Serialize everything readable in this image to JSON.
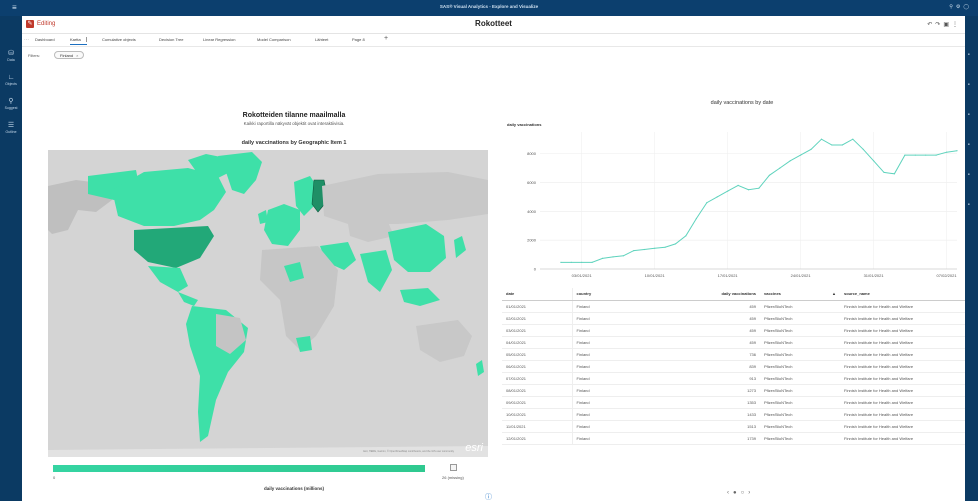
{
  "app_title": "SAS® Visual Analytics - Explore and Visualize",
  "header": {
    "mode_label": "Editing",
    "report_title": "Rokotteet"
  },
  "left_rail": [
    {
      "label": "Data",
      "icon": "database-icon"
    },
    {
      "label": "Objects",
      "icon": "objects-icon"
    },
    {
      "label": "Suggest",
      "icon": "lightbulb-icon"
    },
    {
      "label": "Outline",
      "icon": "outline-icon"
    }
  ],
  "tabs": [
    {
      "label": "Dashboard"
    },
    {
      "label": "Kartta",
      "active": true
    },
    {
      "label": "Cumulative objects"
    },
    {
      "label": "Decision Tree"
    },
    {
      "label": "Linear Regression"
    },
    {
      "label": "Model Comparison"
    },
    {
      "label": "Lähteet"
    },
    {
      "label": "Page 8"
    }
  ],
  "filters": {
    "label": "Filters:",
    "chip": "Finland"
  },
  "left_panel": {
    "title": "Rokotteiden tilanne maailmalla",
    "subtitle": "Kaikki raportilla näkyvät objektit ovat interaktiivisia.",
    "map_title": "daily vaccinations by Geographic Item 1",
    "map_logo": "esri",
    "map_attribution": "Esri, HERE, Garmin, © OpenStreetMap contributors, and the GIS user community",
    "legend": {
      "title": "daily vaccinations (millions)",
      "min": "0",
      "max": "26",
      "missing": "(missing)",
      "fill_fraction": 1.0,
      "color": "#33d19c"
    }
  },
  "chart_data": {
    "type": "line",
    "title": "daily vaccinations by date",
    "ylabel": "daily vaccinations",
    "xlabel": "",
    "x_start": "2020-12-30",
    "x_end": "2021-02-08",
    "ylim": [
      0,
      9500
    ],
    "y_ticks": [
      0,
      2000,
      4000,
      6000,
      8000
    ],
    "x_ticks": [
      "03/01/2021",
      "10/01/2021",
      "17/01/2021",
      "24/01/2021",
      "31/01/2021",
      "07/02/2021"
    ],
    "color": "#5fd3bd",
    "series": [
      {
        "x": [
          "2021-01-01",
          "2021-01-02",
          "2021-01-03",
          "2021-01-04",
          "2021-01-05",
          "2021-01-06",
          "2021-01-07",
          "2021-01-08",
          "2021-01-09",
          "2021-01-10",
          "2021-01-11",
          "2021-01-12",
          "2021-01-13",
          "2021-01-14",
          "2021-01-15",
          "2021-01-16",
          "2021-01-17",
          "2021-01-18",
          "2021-01-19",
          "2021-01-20",
          "2021-01-21",
          "2021-01-22",
          "2021-01-23",
          "2021-01-24",
          "2021-01-25",
          "2021-01-26",
          "2021-01-27",
          "2021-01-28",
          "2021-01-29",
          "2021-01-30",
          "2021-01-31",
          "2021-02-01",
          "2021-02-02",
          "2021-02-03",
          "2021-02-04",
          "2021-02-05",
          "2021-02-06",
          "2021-02-07",
          "2021-02-08"
        ],
        "values": [
          459,
          459,
          459,
          459,
          736,
          839,
          913,
          1273,
          1353,
          1433,
          1513,
          1739,
          2300,
          3500,
          4600,
          5000,
          5400,
          5800,
          5500,
          5600,
          6500,
          7000,
          7500,
          7900,
          8300,
          9000,
          8600,
          8600,
          9000,
          8300,
          7500,
          6700,
          6600,
          7900,
          7900,
          7900,
          7900,
          8100,
          8200
        ]
      }
    ]
  },
  "table": {
    "columns": [
      "date",
      "country",
      "daily vaccinations",
      "vaccines",
      "source_name"
    ],
    "sort_indicator": "▲",
    "rows": [
      [
        "01/01/2021",
        "Finland",
        "459",
        "Pfizer/BioNTech",
        "Finnish Institute for Health and Welfare"
      ],
      [
        "02/01/2021",
        "Finland",
        "459",
        "Pfizer/BioNTech",
        "Finnish Institute for Health and Welfare"
      ],
      [
        "03/01/2021",
        "Finland",
        "459",
        "Pfizer/BioNTech",
        "Finnish Institute for Health and Welfare"
      ],
      [
        "04/01/2021",
        "Finland",
        "459",
        "Pfizer/BioNTech",
        "Finnish Institute for Health and Welfare"
      ],
      [
        "05/01/2021",
        "Finland",
        "736",
        "Pfizer/BioNTech",
        "Finnish Institute for Health and Welfare"
      ],
      [
        "06/01/2021",
        "Finland",
        "839",
        "Pfizer/BioNTech",
        "Finnish Institute for Health and Welfare"
      ],
      [
        "07/01/2021",
        "Finland",
        "913",
        "Pfizer/BioNTech",
        "Finnish Institute for Health and Welfare"
      ],
      [
        "08/01/2021",
        "Finland",
        "1273",
        "Pfizer/BioNTech",
        "Finnish Institute for Health and Welfare"
      ],
      [
        "09/01/2021",
        "Finland",
        "1353",
        "Pfizer/BioNTech",
        "Finnish Institute for Health and Welfare"
      ],
      [
        "10/01/2021",
        "Finland",
        "1433",
        "Pfizer/BioNTech",
        "Finnish Institute for Health and Welfare"
      ],
      [
        "11/01/2021",
        "Finland",
        "1513",
        "Pfizer/BioNTech",
        "Finnish Institute for Health and Welfare"
      ],
      [
        "12/01/2021",
        "Finland",
        "1739",
        "Pfizer/BioNTech",
        "Finnish Institute for Health and Welfare"
      ]
    ]
  },
  "pager": {
    "dots": [
      "‹",
      "●",
      "○",
      "›"
    ]
  },
  "colors": {
    "accent": "#1c6fc0",
    "chrome": "#0b3a63",
    "map_fill": "#3ee0a8",
    "map_fill_dark": "#22a878",
    "map_base": "#c8c8c8",
    "edit_red": "#c0392b"
  }
}
